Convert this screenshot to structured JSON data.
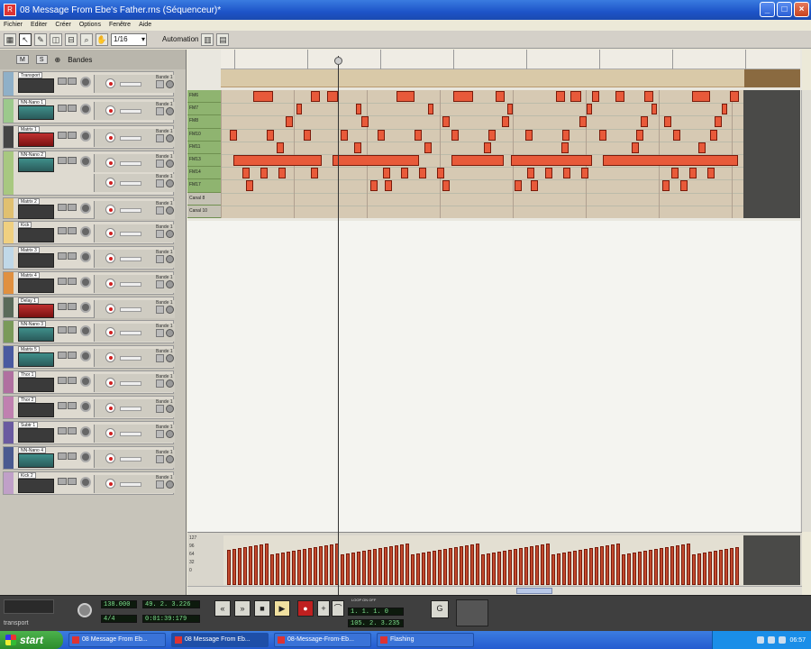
{
  "window": {
    "title": "08 Message From Ebe's Father.rns (Séquenceur)*"
  },
  "menu": [
    "Fichier",
    "Editer",
    "Créer",
    "Options",
    "Fenêtre",
    "Aide"
  ],
  "toolbar": {
    "snap_value": "1/16",
    "automation_label": "Automation"
  },
  "track_panel": {
    "header_label": "Bandes",
    "tracks": [
      {
        "name": "Transport",
        "color": "#8fb0c8",
        "device": "plain"
      },
      {
        "name": "NN-Nano 1",
        "color": "#9cc98c",
        "device": "teal"
      },
      {
        "name": "Matrix 1",
        "color": "#444444",
        "device": "red"
      },
      {
        "name": "NN-Nano 2",
        "color": "#a8c880",
        "device": "teal"
      },
      {
        "name": "Matrix 2",
        "color": "#e0c070",
        "device": "plain"
      },
      {
        "name": "Kick",
        "color": "#f0d080",
        "device": "dark"
      },
      {
        "name": "Matrix 3",
        "color": "#c0d8e8",
        "device": "plain"
      },
      {
        "name": "Matrix 4",
        "color": "#e09040",
        "device": "plain"
      },
      {
        "name": "Delay 1",
        "color": "#5a6a5a",
        "device": "red"
      },
      {
        "name": "NN-Nano 3",
        "color": "#7a9a5a",
        "device": "teal"
      },
      {
        "name": "Matrix 5",
        "color": "#4a5aa0",
        "device": "teal"
      },
      {
        "name": "Thor 1",
        "color": "#b070a0",
        "device": "dark"
      },
      {
        "name": "Thor 2",
        "color": "#c080b0",
        "device": "dark"
      },
      {
        "name": "Subtr 1",
        "color": "#6a5aa0",
        "device": "plain"
      },
      {
        "name": "NN-Nano 4",
        "color": "#4a5a90",
        "device": "teal"
      },
      {
        "name": "Kick 2",
        "color": "#c0a0c8",
        "device": "dark"
      }
    ],
    "lane_label": "Bande 1"
  },
  "drum_editor": {
    "keys": [
      "FM6",
      "FM7",
      "FM8",
      "FM10",
      "FM11",
      "FM13",
      "FM14",
      "FM17",
      "Canal 8",
      "Canal 10"
    ]
  },
  "velocity": {
    "labels": [
      "127",
      "96",
      "64",
      "32",
      "0"
    ]
  },
  "transport": {
    "tempo": "138.000",
    "signature": "4/4",
    "position": "49. 2. 3.226",
    "time": "0:01:39:179",
    "loop_left": "1. 1. 1. 0",
    "loop_right": "105. 2. 3.235",
    "loop_label": "LOOP ON OFF",
    "transport_label": "transport"
  },
  "taskbar": {
    "start_label": "start",
    "items": [
      "08 Message From Eb...",
      "08 Message From Eb...",
      "08-Message-From-Eb...",
      "Flashing"
    ],
    "clock": "06:57"
  },
  "colors": {
    "note": "#e85a3a",
    "grid": "#d6c9b3",
    "keylist": "#8fb470"
  }
}
